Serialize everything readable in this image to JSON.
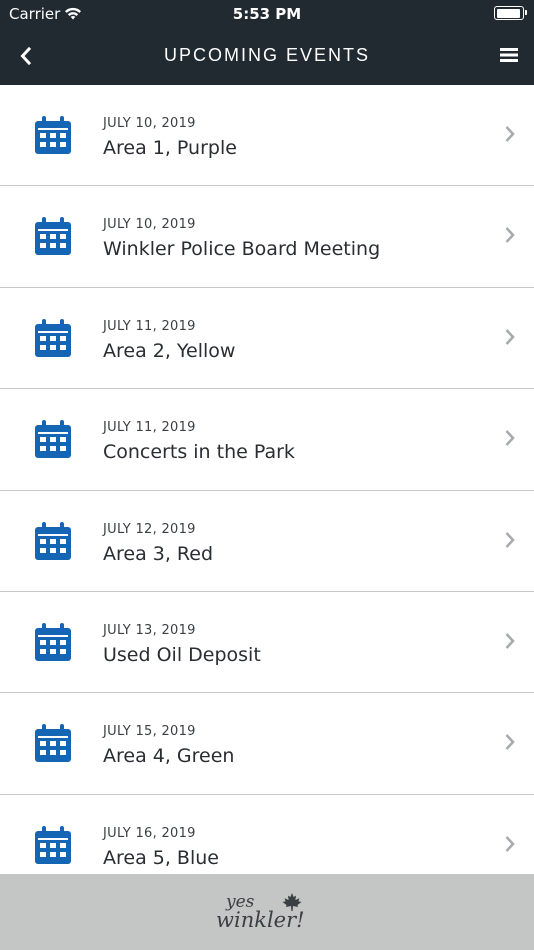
{
  "status_bar": {
    "carrier": "Carrier",
    "time": "5:53 PM",
    "battery_level": 0.95
  },
  "nav": {
    "title": "UPCOMING EVENTS",
    "back_icon": "chevron-left-icon",
    "menu_icon": "hamburger-menu-icon"
  },
  "colors": {
    "nav_background": "#222a31",
    "accent_blue": "#1565b5",
    "footer_background": "#c3c6c5"
  },
  "events": [
    {
      "date": "JULY 10, 2019",
      "name": "Area 1, Purple"
    },
    {
      "date": "JULY 10, 2019",
      "name": "Winkler Police Board Meeting"
    },
    {
      "date": "JULY 11, 2019",
      "name": "Area 2, Yellow"
    },
    {
      "date": "JULY 11, 2019",
      "name": "Concerts in the Park"
    },
    {
      "date": "JULY 12, 2019",
      "name": "Area 3, Red"
    },
    {
      "date": "JULY 13, 2019",
      "name": "Used Oil Deposit"
    },
    {
      "date": "JULY 15, 2019",
      "name": "Area 4, Green"
    },
    {
      "date": "JULY 16, 2019",
      "name": "Area 5, Blue"
    }
  ],
  "footer": {
    "logo_line1": "yes",
    "logo_line2": "winkler!"
  }
}
